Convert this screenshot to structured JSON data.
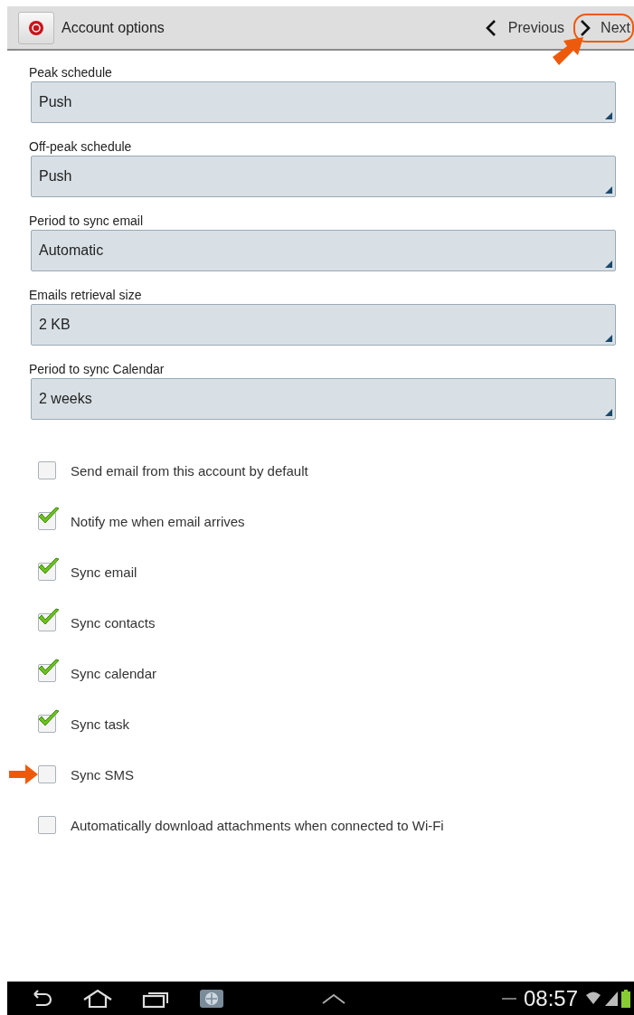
{
  "title_bar": {
    "title": "Account options",
    "previous": {
      "label": "Previous",
      "highlighted": false
    },
    "next": {
      "label": "Next",
      "highlighted": true
    }
  },
  "dropdowns": [
    {
      "label": "Peak schedule",
      "value": "Push"
    },
    {
      "label": "Off-peak schedule",
      "value": "Push"
    },
    {
      "label": "Period to sync email",
      "value": "Automatic"
    },
    {
      "label": "Emails retrieval size",
      "value": "2 KB"
    },
    {
      "label": "Period to sync Calendar",
      "value": "2 weeks"
    }
  ],
  "options": [
    {
      "label": "Send email from this account by default",
      "checked": false,
      "pointed": false
    },
    {
      "label": "Notify me when email arrives",
      "checked": true,
      "pointed": false
    },
    {
      "label": "Sync email",
      "checked": true,
      "pointed": false
    },
    {
      "label": "Sync contacts",
      "checked": true,
      "pointed": false
    },
    {
      "label": "Sync calendar",
      "checked": true,
      "pointed": false
    },
    {
      "label": "Sync task",
      "checked": true,
      "pointed": false
    },
    {
      "label": "Sync SMS",
      "checked": false,
      "pointed": true
    },
    {
      "label": "Automatically download attachments when connected to Wi-Fi",
      "checked": false,
      "pointed": false
    }
  ],
  "system_bar": {
    "time": "08:57"
  }
}
